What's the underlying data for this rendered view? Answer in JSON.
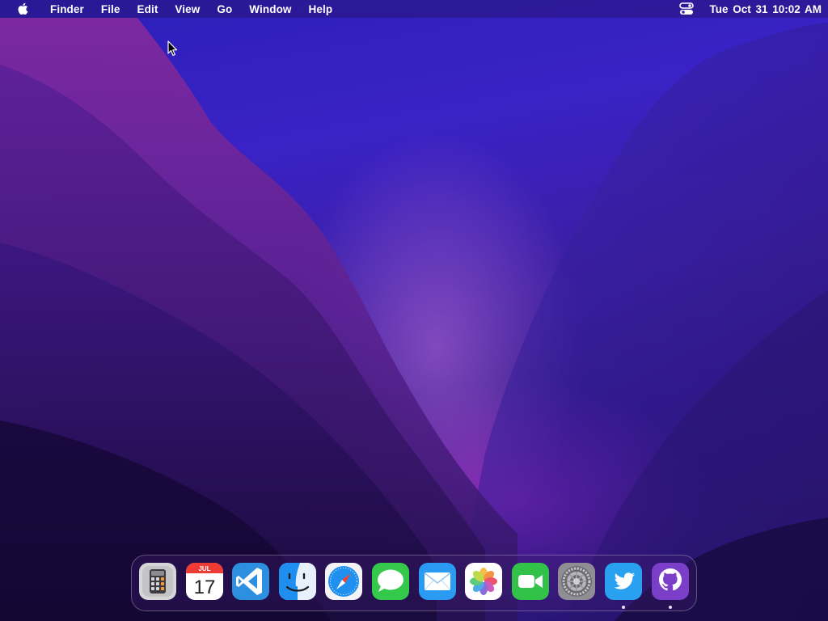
{
  "menubar": {
    "apple_icon": "apple-icon",
    "items": [
      {
        "label": "Finder"
      },
      {
        "label": "File"
      },
      {
        "label": "Edit"
      },
      {
        "label": "View"
      },
      {
        "label": "Go"
      },
      {
        "label": "Window"
      },
      {
        "label": "Help"
      }
    ],
    "control_center_icon": "control-center-icon",
    "clock": "Tue Oct 31  10:02 AM"
  },
  "dock": {
    "apps": [
      {
        "icon": "calculator-icon",
        "running": false
      },
      {
        "icon": "calendar-icon",
        "running": false,
        "month": "JUL",
        "day": "17"
      },
      {
        "icon": "vscode-icon",
        "running": false
      },
      {
        "icon": "finder-icon",
        "running": false
      },
      {
        "icon": "safari-icon",
        "running": false
      },
      {
        "icon": "messages-icon",
        "running": false
      },
      {
        "icon": "mail-icon",
        "running": false
      },
      {
        "icon": "photos-icon",
        "running": false
      },
      {
        "icon": "facetime-icon",
        "running": false
      },
      {
        "icon": "system-preferences-icon",
        "running": false
      },
      {
        "icon": "twitter-icon",
        "running": true
      },
      {
        "icon": "github-icon",
        "running": true
      }
    ]
  },
  "colors": {
    "wallpaper_top": "#2a1fb8",
    "wallpaper_bottom": "#1a0c4e",
    "accent_magenta": "#aa28c8"
  }
}
